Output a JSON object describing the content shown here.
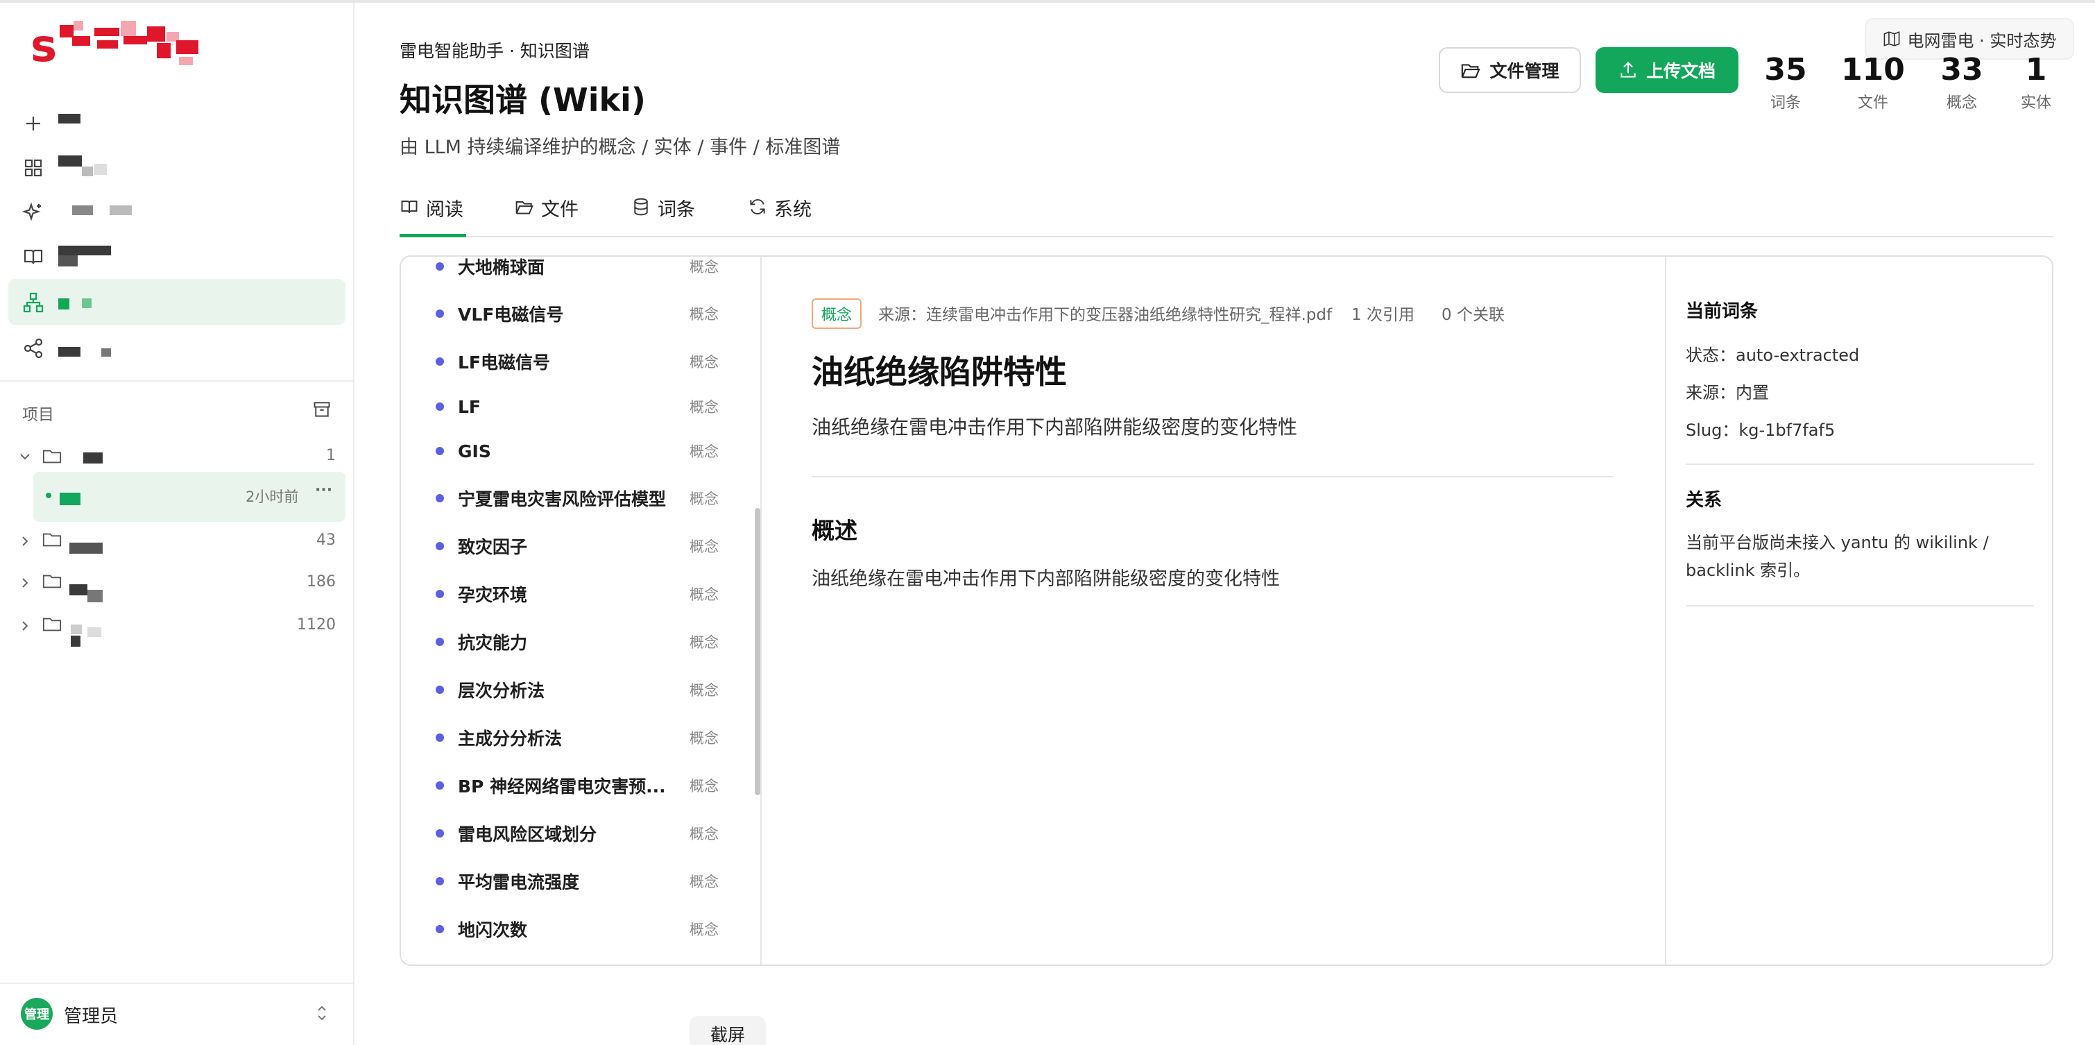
{
  "sidebar": {
    "section_label": "项目",
    "project_counts": [
      "1",
      "43",
      "186",
      "1120"
    ],
    "active_project_time": "2小时前",
    "more_label": "···",
    "user": {
      "avatar_text": "管理",
      "name": "管理员"
    }
  },
  "header": {
    "breadcrumb": "雷电智能助手 · 知识图谱",
    "title": "知识图谱 (Wiki)",
    "subtitle": "由 LLM 持续编译维护的概念 / 实体 / 事件 / 标准图谱",
    "files_button": "文件管理",
    "upload_button": "上传文档",
    "live_badge": "电网雷电 · 实时态势",
    "stats": [
      {
        "value": "35",
        "label": "词条"
      },
      {
        "value": "110",
        "label": "文件"
      },
      {
        "value": "33",
        "label": "概念"
      },
      {
        "value": "1",
        "label": "实体"
      }
    ]
  },
  "tabs": [
    {
      "label": "阅读",
      "icon": "book-icon"
    },
    {
      "label": "文件",
      "icon": "folder-icon"
    },
    {
      "label": "词条",
      "icon": "database-icon"
    },
    {
      "label": "系统",
      "icon": "refresh-icon"
    }
  ],
  "term_list": [
    {
      "name": "大地椭球面",
      "tag": "概念"
    },
    {
      "name": "VLF电磁信号",
      "tag": "概念"
    },
    {
      "name": "LF电磁信号",
      "tag": "概念"
    },
    {
      "name": "LF",
      "tag": "概念"
    },
    {
      "name": "GIS",
      "tag": "概念"
    },
    {
      "name": "宁夏雷电灾害风险评估模型",
      "tag": "概念"
    },
    {
      "name": "致灾因子",
      "tag": "概念"
    },
    {
      "name": "孕灾环境",
      "tag": "概念"
    },
    {
      "name": "抗灾能力",
      "tag": "概念"
    },
    {
      "name": "层次分析法",
      "tag": "概念"
    },
    {
      "name": "主成分分析法",
      "tag": "概念"
    },
    {
      "name": "BP 神经网络雷电灾害预...",
      "tag": "概念"
    },
    {
      "name": "雷电风险区域划分",
      "tag": "概念"
    },
    {
      "name": "平均雷电流强度",
      "tag": "概念"
    },
    {
      "name": "地闪次数",
      "tag": "概念"
    }
  ],
  "detail": {
    "type_tag": "概念",
    "source": "来源：连续雷电冲击作用下的变压器油纸绝缘特性研究_程祥.pdf",
    "citations": "1 次引用",
    "relations": "0 个关联",
    "title": "油纸绝缘陷阱特性",
    "description": "油纸绝缘在雷电冲击作用下内部陷阱能级密度的变化特性",
    "overview_heading": "概述",
    "overview_text": "油纸绝缘在雷电冲击作用下内部陷阱能级密度的变化特性"
  },
  "side_panel": {
    "current_heading": "当前词条",
    "status": "状态：auto-extracted",
    "source": "来源：内置",
    "slug": "Slug：kg-1bf7faf5",
    "relations_heading": "关系",
    "relations_line1": "当前平台版尚未接入 yantu 的 wikilink /",
    "relations_line2": "backlink 索引。"
  },
  "screenshot_button": "截屏"
}
